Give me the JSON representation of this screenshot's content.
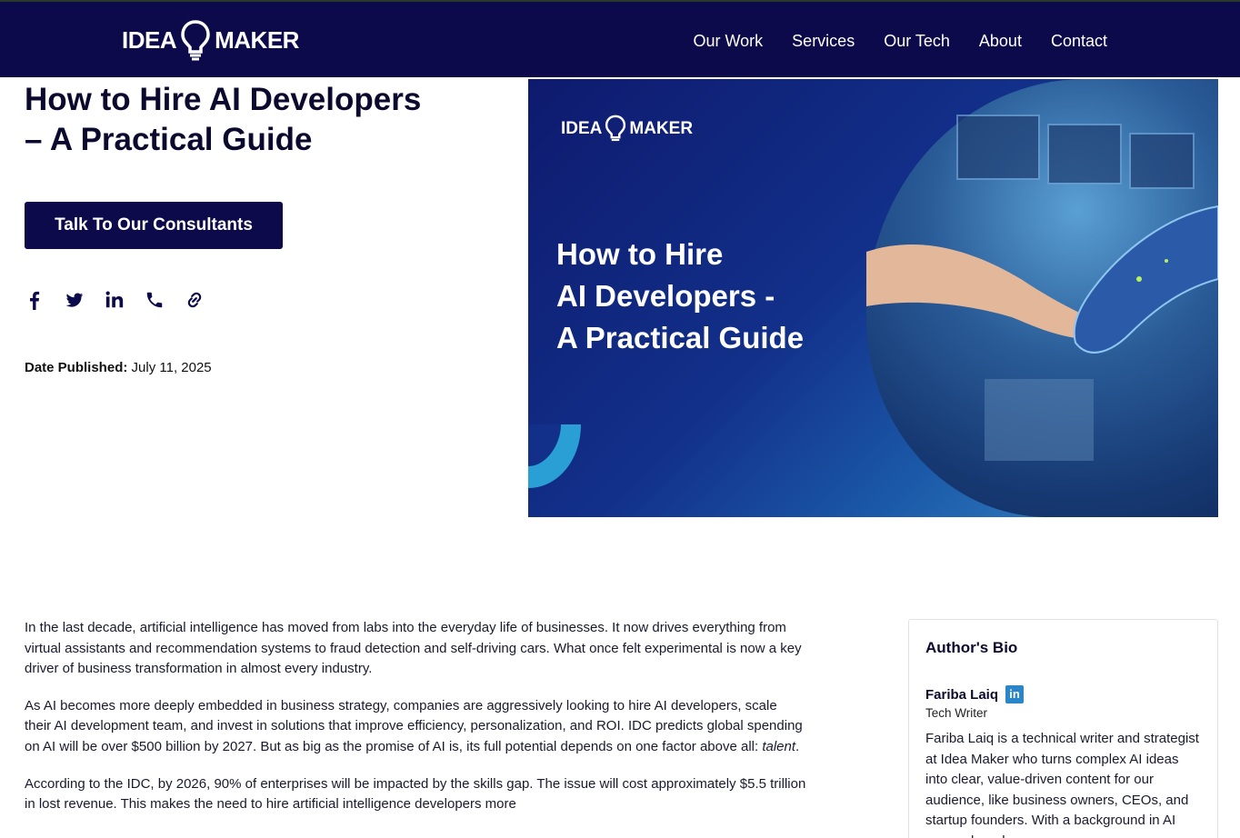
{
  "header": {
    "logo_left": "IDEA",
    "logo_right": "MAKER",
    "nav": [
      "Our Work",
      "Services",
      "Our Tech",
      "About",
      "Contact"
    ]
  },
  "hero": {
    "title_line1": "How to Hire AI Developers",
    "title_line2": "– A Practical Guide",
    "cta_label": "Talk To Our Consultants",
    "share_icons": [
      "facebook-icon",
      "twitter-icon",
      "linkedin-icon",
      "phone-icon",
      "link-icon"
    ],
    "date_label": "Date Published:",
    "date_value": "July 11, 2025"
  },
  "hero_image": {
    "logo_left": "IDEA",
    "logo_right": "MAKER",
    "title_line1": "How to Hire",
    "title_line2": "AI Developers -",
    "title_line3": "A Practical Guide"
  },
  "article": {
    "p1": "In the last decade, artificial intelligence has moved from labs into the everyday life of businesses. It now drives everything from virtual assistants and recommendation systems to fraud detection and self-driving cars. What once felt experimental is now a key driver of business transformation in almost every industry.",
    "p2_main": "As AI becomes more deeply embedded in business strategy, companies are aggressively looking to hire AI developers, scale their AI development team, and invest in solutions that improve efficiency, personalization, and ROI. IDC predicts global spending on AI will be over $500 billion by 2027. But as big as the promise of AI is, its full potential depends on one factor above all: ",
    "p2_em": "talent",
    "p2_end": ".",
    "p3": "According to the IDC, by 2026, 90% of enterprises will be impacted by the skills gap. The issue will cost approximately $5.5 trillion in lost revenue. This makes the need to hire artificial intelligence developers more"
  },
  "author": {
    "heading": "Author's Bio",
    "name": "Fariba Laiq",
    "linkedin_badge": "in",
    "role": "Tech Writer",
    "bio": "Fariba Laiq is a technical writer and strategist at Idea Maker who turns complex AI ideas into clear, value-driven content for our audience, like business owners, CEOs, and startup founders. With a background in AI research and"
  },
  "colors": {
    "navy": "#0c0a4a",
    "accent_blue": "#2a86c8"
  }
}
